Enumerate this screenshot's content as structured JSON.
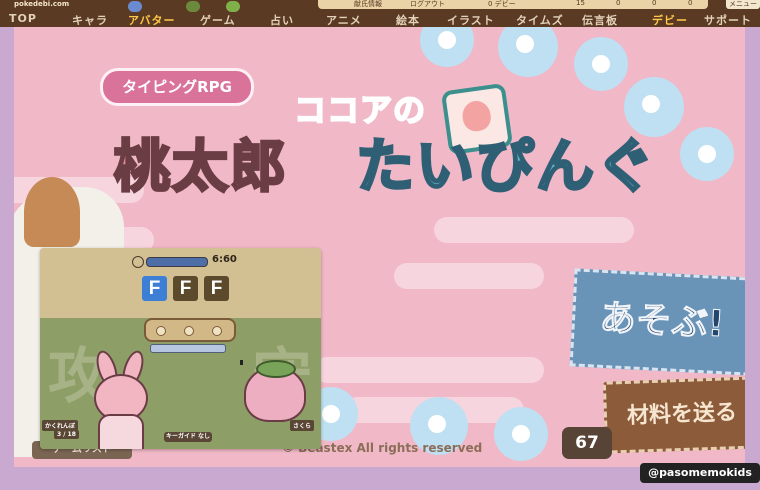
{
  "site": {
    "domain": "pokedebi.com"
  },
  "nav": {
    "items": [
      "TOP",
      "キャラ",
      "アバター",
      "ゲーム",
      "占い",
      "アニメ",
      "絵本",
      "イラスト",
      "タイムズ",
      "伝言板",
      "デビー",
      "サポート"
    ],
    "highlighted": [
      "アバター",
      "デビー"
    ],
    "menu_label": "メニュー",
    "ranking": {
      "left": "献氏情報",
      "right": "ログアウト",
      "points": "0 デビー",
      "values": [
        "15",
        "0",
        "0",
        "0"
      ]
    }
  },
  "game": {
    "genre_tag": "タイピングRPG",
    "title_part1": "ココアの",
    "title_part2": "桃太郎",
    "title_part3": "たいぴんぐ",
    "play_button": "あそぶ!",
    "send_button": "材料を送る",
    "counter": "67",
    "copyright": "© Beastex All rights reserved",
    "back_button": "ゲームリスト"
  },
  "preview": {
    "time": "6:60",
    "keys": [
      {
        "char": "F",
        "color": "#3d7fd4"
      },
      {
        "char": "F",
        "color": "#5c4a2c"
      },
      {
        "char": "F",
        "color": "#5c4a2c"
      }
    ],
    "kanji_left": "攻",
    "kanji_right": "守",
    "player_name": "かくれんぼ",
    "player_hp": "3 / 18",
    "key_guide": "キーガイド なし",
    "enemy_label": "さくら"
  },
  "watermark": {
    "handle": "@pasomemokids"
  },
  "colors": {
    "nav_bg": "#5a3a22",
    "stage_bg": "#f1b8c7",
    "accent_teal": "#5bb8c2",
    "accent_pink": "#ea8a97",
    "play_blue": "#6a93b8",
    "send_brown": "#8c5b3a"
  }
}
